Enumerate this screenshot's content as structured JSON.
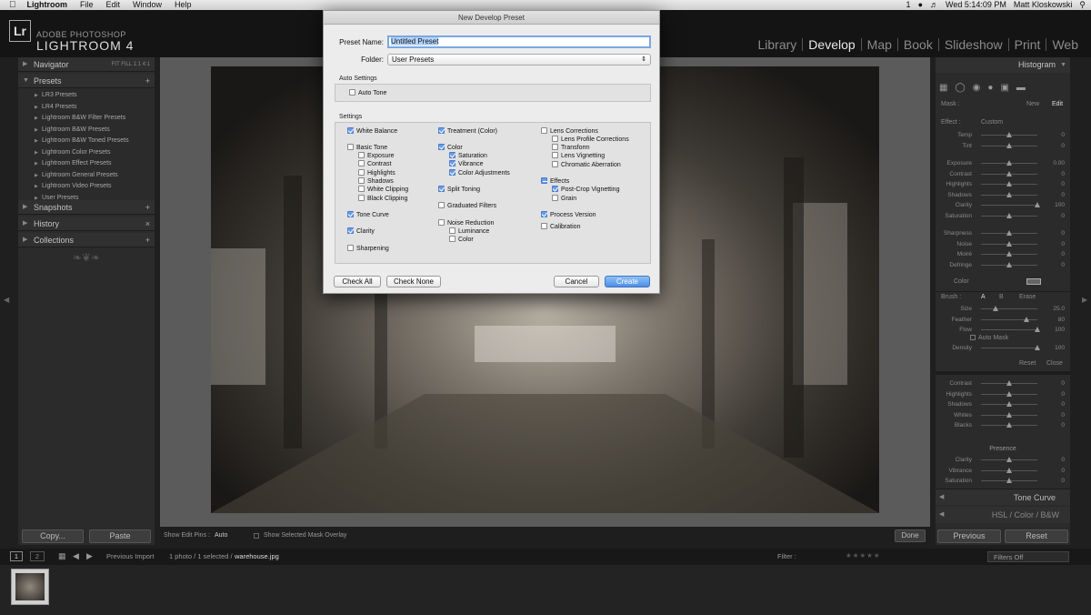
{
  "menubar": {
    "apple": "",
    "items": [
      "Lightroom",
      "File",
      "Edit",
      "Window",
      "Help"
    ],
    "clock": "Wed 5:14:09 PM",
    "user": "Matt Kloskowski",
    "status_num": "1"
  },
  "app": {
    "logo": "Lr",
    "brand_small": "ADOBE PHOTOSHOP",
    "brand_big": "LIGHTROOM 4",
    "modules": [
      "Library",
      "Develop",
      "Map",
      "Book",
      "Slideshow",
      "Print",
      "Web"
    ],
    "active_module": "Develop"
  },
  "left_panel": {
    "navigator": {
      "title": "Navigator",
      "modes": "FIT  FILL  1:1  4:1"
    },
    "presets": {
      "title": "Presets",
      "add": "+",
      "items": [
        "LR3 Presets",
        "LR4 Presets",
        "Lightroom B&W Filter Presets",
        "Lightroom B&W Presets",
        "Lightroom B&W Toned Presets",
        "Lightroom Color Presets",
        "Lightroom Effect Presets",
        "Lightroom General Presets",
        "Lightroom Video Presets",
        "User Presets"
      ]
    },
    "snapshots": {
      "title": "Snapshots",
      "add": "+"
    },
    "history": {
      "title": "History",
      "clear": "×"
    },
    "collections": {
      "title": "Collections",
      "add": "+"
    },
    "copy_button": "Copy...",
    "paste_button": "Paste"
  },
  "right_panel": {
    "histogram": "Histogram",
    "mask": {
      "label": "Mask :",
      "new": "New",
      "edit": "Edit"
    },
    "effect": {
      "label": "Effect :",
      "value": "Custom"
    },
    "sliders1": [
      {
        "label": "Temp",
        "value": "0",
        "pos": 0.5
      },
      {
        "label": "Tint",
        "value": "0",
        "pos": 0.5
      }
    ],
    "sliders2": [
      {
        "label": "Exposure",
        "value": "0.00",
        "pos": 0.5
      },
      {
        "label": "Contrast",
        "value": "0",
        "pos": 0.5
      },
      {
        "label": "Highlights",
        "value": "0",
        "pos": 0.5
      },
      {
        "label": "Shadows",
        "value": "0",
        "pos": 0.5
      },
      {
        "label": "Clarity",
        "value": "100",
        "pos": 1.0
      },
      {
        "label": "Saturation",
        "value": "0",
        "pos": 0.5
      }
    ],
    "sliders3": [
      {
        "label": "Sharpness",
        "value": "0",
        "pos": 0.5
      },
      {
        "label": "Noise",
        "value": "0",
        "pos": 0.5
      },
      {
        "label": "Moiré",
        "value": "0",
        "pos": 0.5
      },
      {
        "label": "Defringe",
        "value": "0",
        "pos": 0.5
      }
    ],
    "color_label": "Color",
    "brush": {
      "label": "Brush :",
      "a": "A",
      "b": "B",
      "erase": "Erase"
    },
    "brush_sliders": [
      {
        "label": "Size",
        "value": "25.0",
        "pos": 0.25
      },
      {
        "label": "Feather",
        "value": "80",
        "pos": 0.8
      },
      {
        "label": "Flow",
        "value": "100",
        "pos": 1.0
      }
    ],
    "auto_mask": "Auto Mask",
    "density": {
      "label": "Density",
      "value": "100",
      "pos": 1.0
    },
    "reset": "Reset",
    "close": "Close",
    "tone_sliders": [
      {
        "label": "Contrast",
        "value": "0",
        "pos": 0.5
      },
      {
        "label": "Highlights",
        "value": "0",
        "pos": 0.5
      },
      {
        "label": "Shadows",
        "value": "0",
        "pos": 0.5
      },
      {
        "label": "Whites",
        "value": "0",
        "pos": 0.5
      },
      {
        "label": "Blacks",
        "value": "0",
        "pos": 0.5
      }
    ],
    "presence": "Presence",
    "presence_sliders": [
      {
        "label": "Clarity",
        "value": "0",
        "pos": 0.5
      },
      {
        "label": "Vibrance",
        "value": "0",
        "pos": 0.5
      },
      {
        "label": "Saturation",
        "value": "0",
        "pos": 0.5
      }
    ],
    "tone_curve": "Tone Curve",
    "hsl": "HSL / Color / B&W",
    "previous_button": "Previous",
    "reset_button": "Reset"
  },
  "toolbar": {
    "show_edit_pins": "Show Edit Pins :",
    "pins_value": "Auto",
    "overlay": "Show Selected Mask Overlay",
    "done": "Done"
  },
  "filmstrip": {
    "source": "Previous Import",
    "count": "1 photo / 1 selected /",
    "file": "warehouse.jpg",
    "filter_label": "Filter :",
    "filters_off": "Filters Off",
    "page1": "1",
    "page2": "2"
  },
  "dialog": {
    "title": "New Develop Preset",
    "preset_name_label": "Preset Name:",
    "preset_name_value": "Untitled Preset",
    "folder_label": "Folder:",
    "folder_value": "User Presets",
    "auto_settings_title": "Auto Settings",
    "auto_tone": "Auto Tone",
    "settings_title": "Settings",
    "col1": [
      {
        "label": "White Balance",
        "checked": true
      },
      {
        "label": "Basic Tone",
        "checked": false
      },
      {
        "label": "Exposure",
        "checked": false,
        "sub": true
      },
      {
        "label": "Contrast",
        "checked": false,
        "sub": true
      },
      {
        "label": "Highlights",
        "checked": false,
        "sub": true
      },
      {
        "label": "Shadows",
        "checked": false,
        "sub": true
      },
      {
        "label": "White Clipping",
        "checked": false,
        "sub": true
      },
      {
        "label": "Black Clipping",
        "checked": false,
        "sub": true
      },
      {
        "label": "Tone Curve",
        "checked": true
      },
      {
        "label": "Clarity",
        "checked": true
      },
      {
        "label": "Sharpening",
        "checked": false
      }
    ],
    "col2": [
      {
        "label": "Treatment (Color)",
        "checked": true
      },
      {
        "label": "Color",
        "checked": true
      },
      {
        "label": "Saturation",
        "checked": true,
        "sub": true
      },
      {
        "label": "Vibrance",
        "checked": true,
        "sub": true
      },
      {
        "label": "Color Adjustments",
        "checked": true,
        "sub": true
      },
      {
        "label": "Split Toning",
        "checked": true
      },
      {
        "label": "Graduated Filters",
        "checked": false
      },
      {
        "label": "Noise Reduction",
        "checked": false
      },
      {
        "label": "Luminance",
        "checked": false,
        "sub": true
      },
      {
        "label": "Color",
        "checked": false,
        "sub": true
      }
    ],
    "col3": [
      {
        "label": "Lens Corrections",
        "checked": false
      },
      {
        "label": "Lens Profile Corrections",
        "checked": false,
        "sub": true
      },
      {
        "label": "Transform",
        "checked": false,
        "sub": true
      },
      {
        "label": "Lens Vignetting",
        "checked": false,
        "sub": true
      },
      {
        "label": "Chromatic Aberration",
        "checked": false,
        "sub": true
      },
      {
        "label": "Effects",
        "checked": "mixed"
      },
      {
        "label": "Post-Crop Vignetting",
        "checked": true,
        "sub": true
      },
      {
        "label": "Grain",
        "checked": false,
        "sub": true
      },
      {
        "label": "Process Version",
        "checked": true
      },
      {
        "label": "Calibration",
        "checked": false
      }
    ],
    "check_all": "Check All",
    "check_none": "Check None",
    "cancel": "Cancel",
    "create": "Create"
  },
  "colors": {
    "accent": "#4f8fe3",
    "panel": "#2b2b2b",
    "background": "#1f1f1f"
  }
}
